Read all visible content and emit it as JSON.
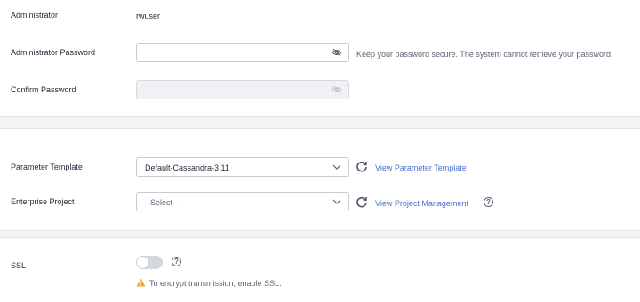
{
  "admin": {
    "label": "Administrator",
    "value": "rwuser"
  },
  "admin_password": {
    "label": "Administrator Password",
    "value": "",
    "hint": "Keep your password secure. The system cannot retrieve your password.",
    "toggle_icon": "eye-off-icon"
  },
  "confirm_password": {
    "label": "Confirm Password",
    "value": "",
    "toggle_icon": "eye-off-icon"
  },
  "parameter_template": {
    "label": "Parameter Template",
    "selected": "Default-Cassandra-3.11",
    "link": "View Parameter Template"
  },
  "enterprise_project": {
    "label": "Enterprise Project",
    "selected": "--Select--",
    "link": "View Project Management",
    "help": "?"
  },
  "ssl": {
    "label": "SSL",
    "enabled": false,
    "help": "?",
    "warning": "To encrypt transmission, enable SSL."
  },
  "colors": {
    "link": "#4a6fcf",
    "warning": "#f5a623",
    "band": "#f2f3f5"
  }
}
